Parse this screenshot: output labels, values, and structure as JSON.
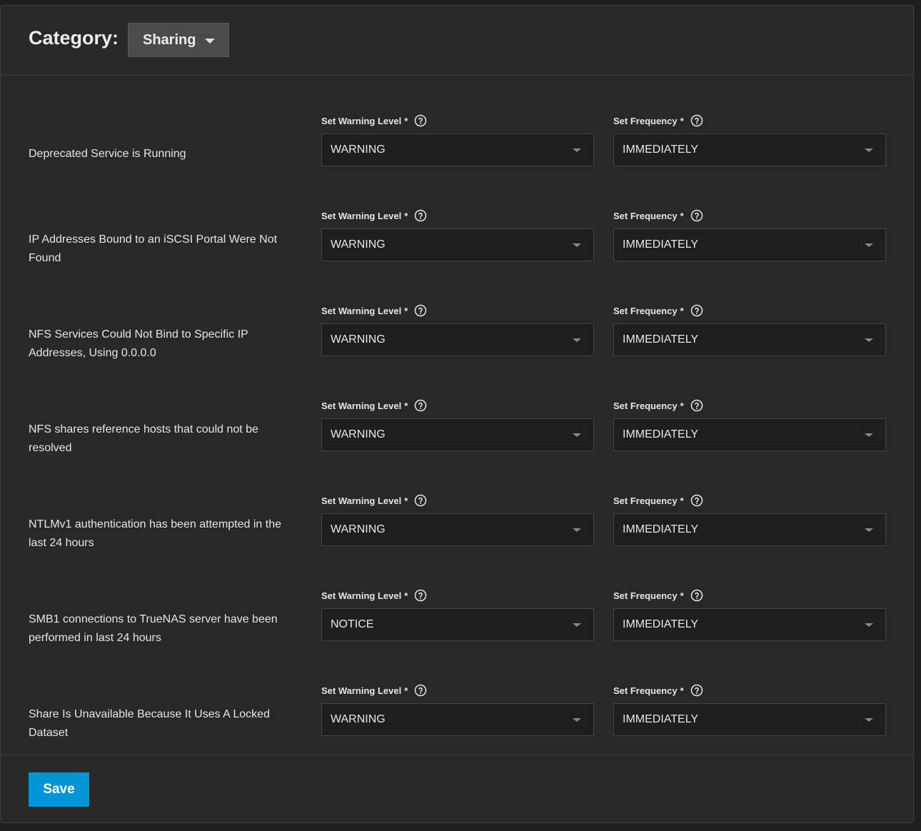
{
  "header": {
    "category_label": "Category:",
    "category_value": "Sharing"
  },
  "field_labels": {
    "warning_level": "Set Warning Level",
    "frequency": "Set Frequency",
    "required_mark": "*"
  },
  "alerts": [
    {
      "label": "Deprecated Service is Running",
      "level": "WARNING",
      "frequency": "IMMEDIATELY"
    },
    {
      "label": "IP Addresses Bound to an iSCSI Portal Were Not Found",
      "level": "WARNING",
      "frequency": "IMMEDIATELY"
    },
    {
      "label": "NFS Services Could Not Bind to Specific IP Addresses, Using 0.0.0.0",
      "level": "WARNING",
      "frequency": "IMMEDIATELY"
    },
    {
      "label": "NFS shares reference hosts that could not be resolved",
      "level": "WARNING",
      "frequency": "IMMEDIATELY"
    },
    {
      "label": "NTLMv1 authentication has been attempted in the last 24 hours",
      "level": "WARNING",
      "frequency": "IMMEDIATELY"
    },
    {
      "label": "SMB1 connections to TrueNAS server have been performed in last 24 hours",
      "level": "NOTICE",
      "frequency": "IMMEDIATELY"
    },
    {
      "label": "Share Is Unavailable Because It Uses A Locked Dataset",
      "level": "WARNING",
      "frequency": "IMMEDIATELY"
    }
  ],
  "footer": {
    "save_label": "Save"
  },
  "colors": {
    "background": "#282828",
    "accent": "#0095d5",
    "category_button": "#4b4b4b"
  }
}
